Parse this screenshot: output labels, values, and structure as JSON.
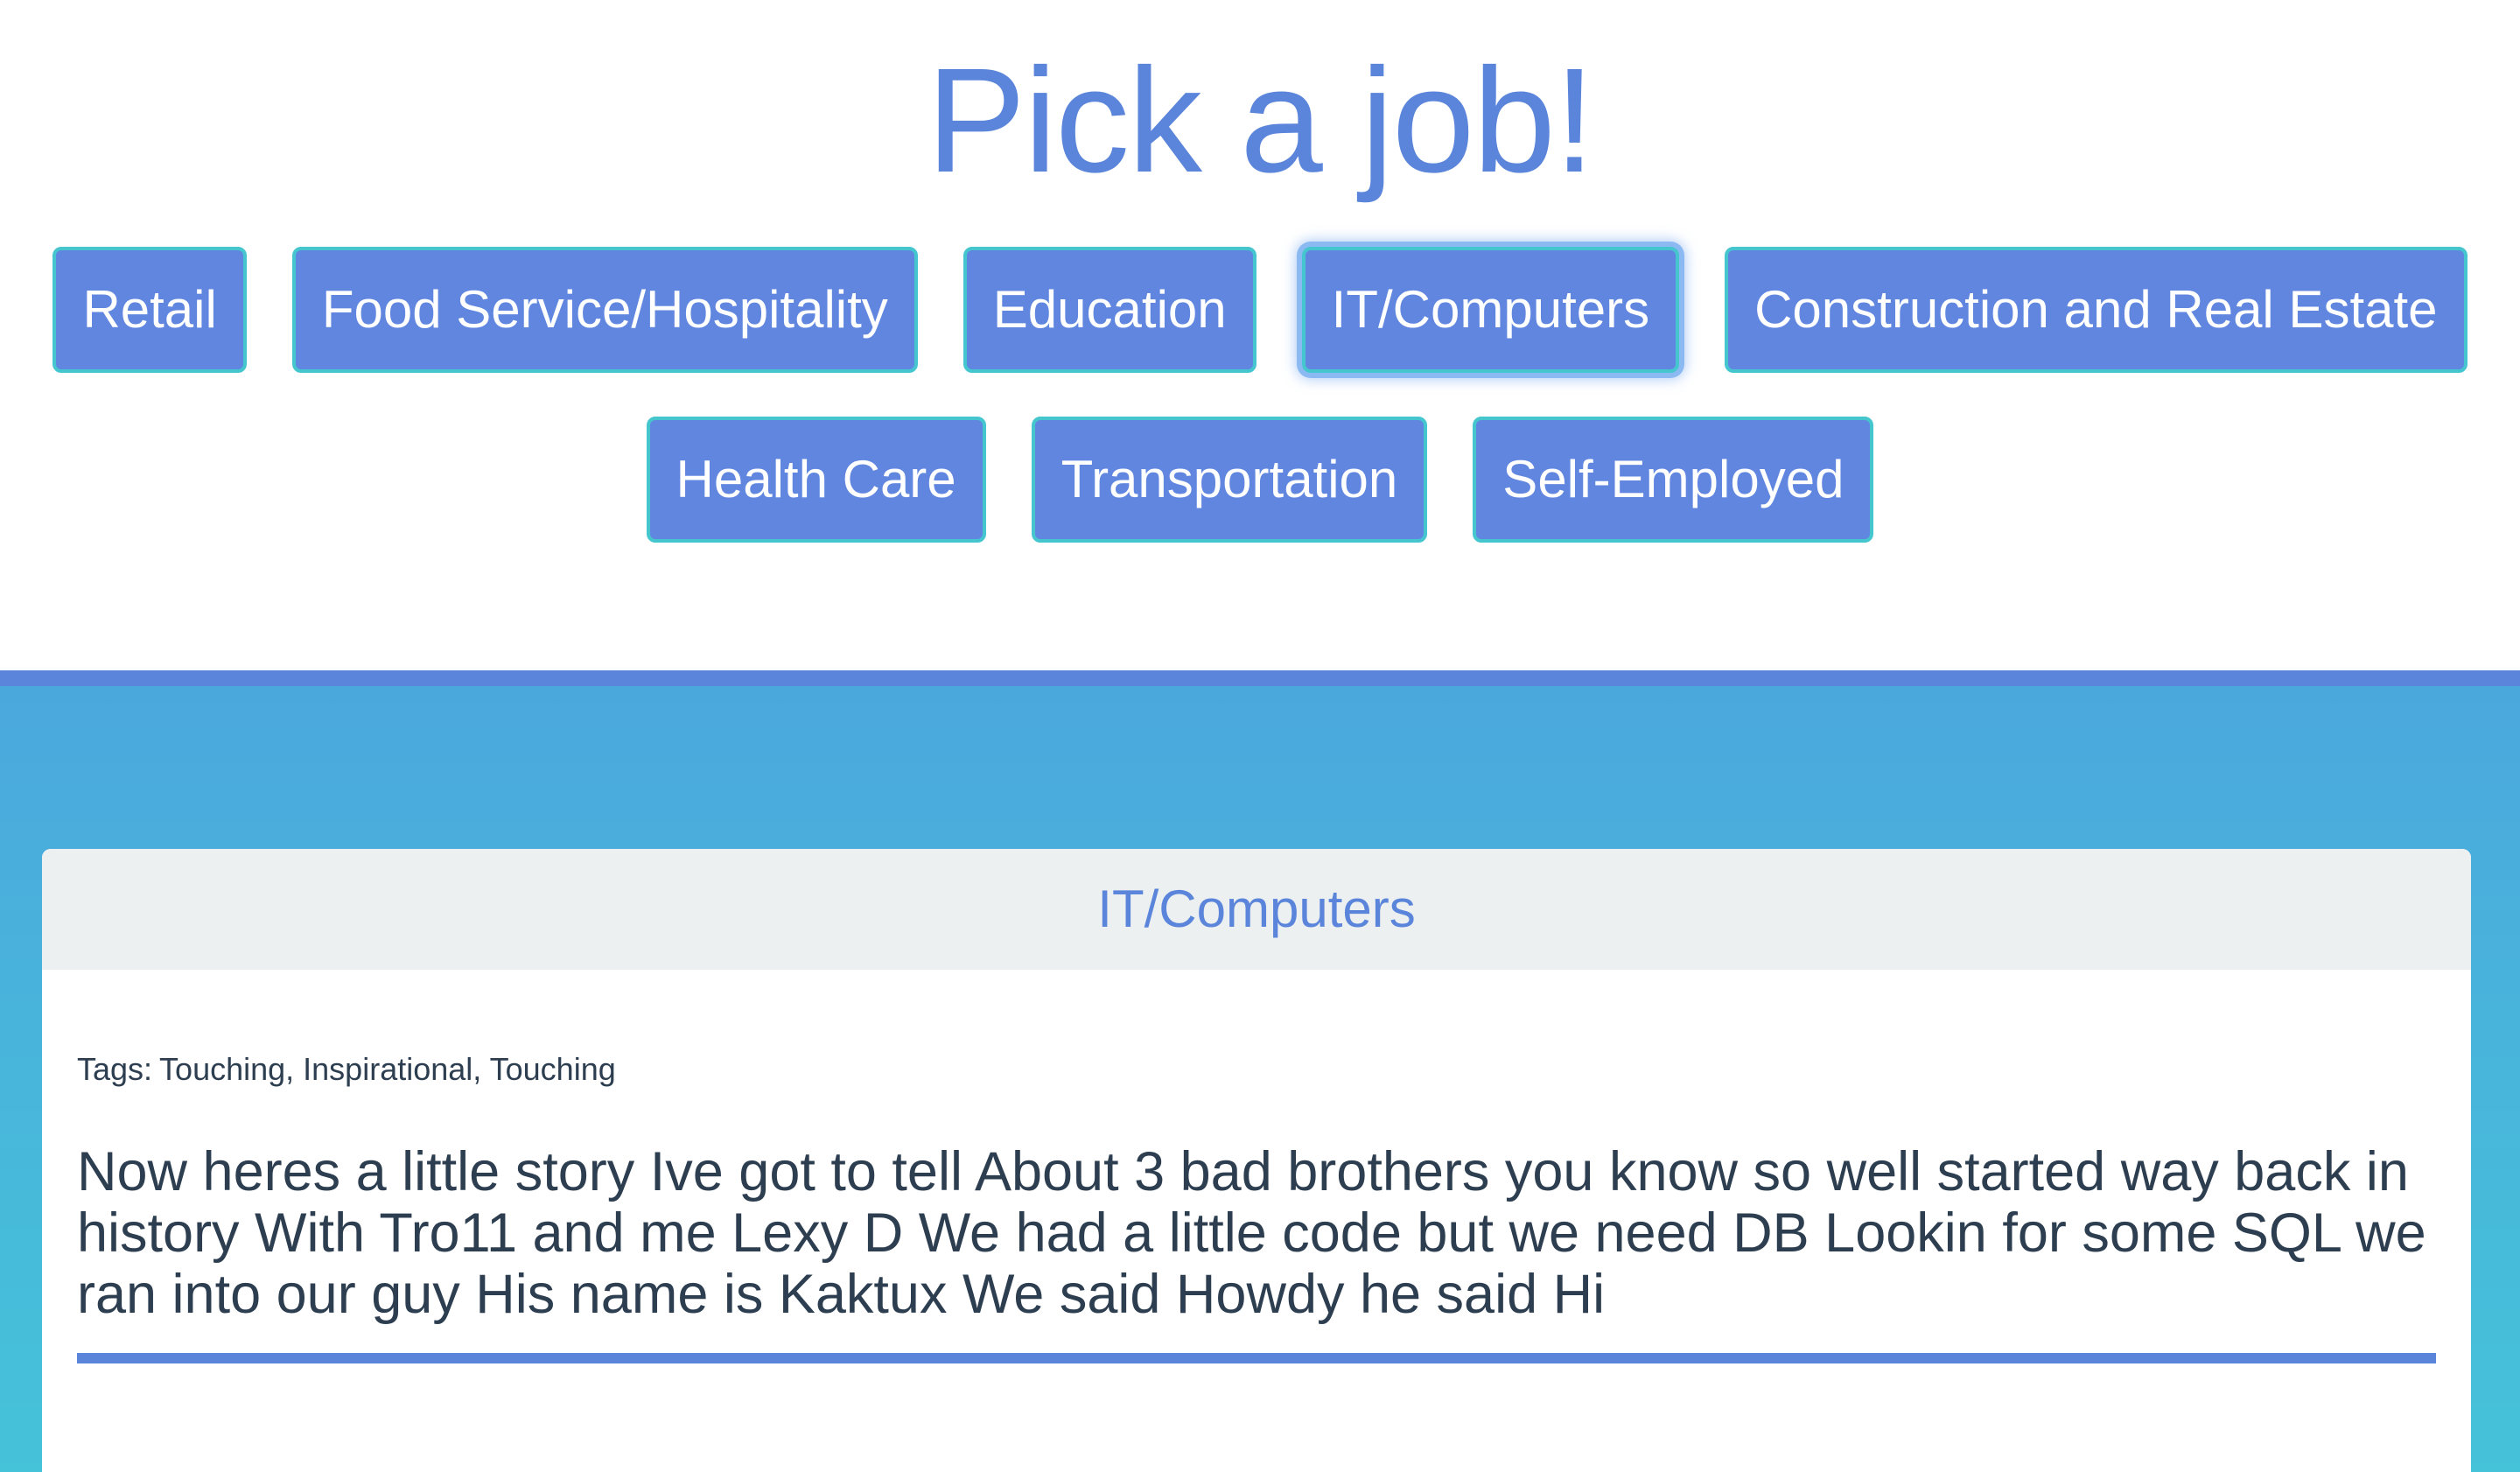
{
  "header": {
    "title": "Pick a job!"
  },
  "jobs": {
    "row1": [
      {
        "label": "Retail"
      },
      {
        "label": "Food Service/Hospitality"
      },
      {
        "label": "Education"
      },
      {
        "label": "IT/Computers",
        "active": true
      },
      {
        "label": "Construction and Real Estate"
      }
    ],
    "row2": [
      {
        "label": "Health Care"
      },
      {
        "label": "Transportation"
      },
      {
        "label": "Self-Employed"
      }
    ]
  },
  "story_card": {
    "category": "IT/Computers",
    "tags_label": "Tags:",
    "tags": "Touching, Inspirational, Touching",
    "text": "Now heres a little story Ive got to tell About 3 bad brothers you know so well started way back in history With Tro11 and me Lexy D We had a little code but we need DB Lookin for some SQL we ran into our guy His name is Kaktux We said Howdy he said Hi"
  },
  "colors": {
    "accent": "#5b85db",
    "button_fill": "#6086e0",
    "button_border": "#45c6cf",
    "gradient_top": "#4ba8dd",
    "gradient_bottom": "#45c3d9",
    "card_header_bg": "#ecf0f1",
    "text_dark": "#2c3e50"
  }
}
